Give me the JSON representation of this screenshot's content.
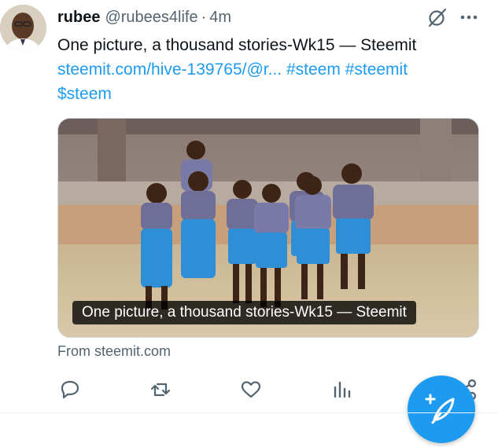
{
  "tweet": {
    "display_name": "rubee",
    "handle": "@rubees4life",
    "separator": "·",
    "timestamp": "4m",
    "text_line": "One picture, a thousand stories-Wk15 — Steemit",
    "link_text": "steemit.com/hive-139765/@r...",
    "hashtags": [
      "#steem",
      "#steemit"
    ],
    "cashtag": "$steem"
  },
  "card": {
    "caption": "One picture, a thousand stories-Wk15 — Steemit",
    "source": "From steemit.com"
  },
  "icons": {
    "grok": "grok-icon",
    "more": "more-icon",
    "reply": "reply-icon",
    "retweet": "retweet-icon",
    "like": "like-icon",
    "views": "views-icon",
    "share": "share-icon",
    "compose": "compose-icon"
  },
  "colors": {
    "accent": "#1d9bf0",
    "text": "#0f1419",
    "muted": "#536471"
  }
}
